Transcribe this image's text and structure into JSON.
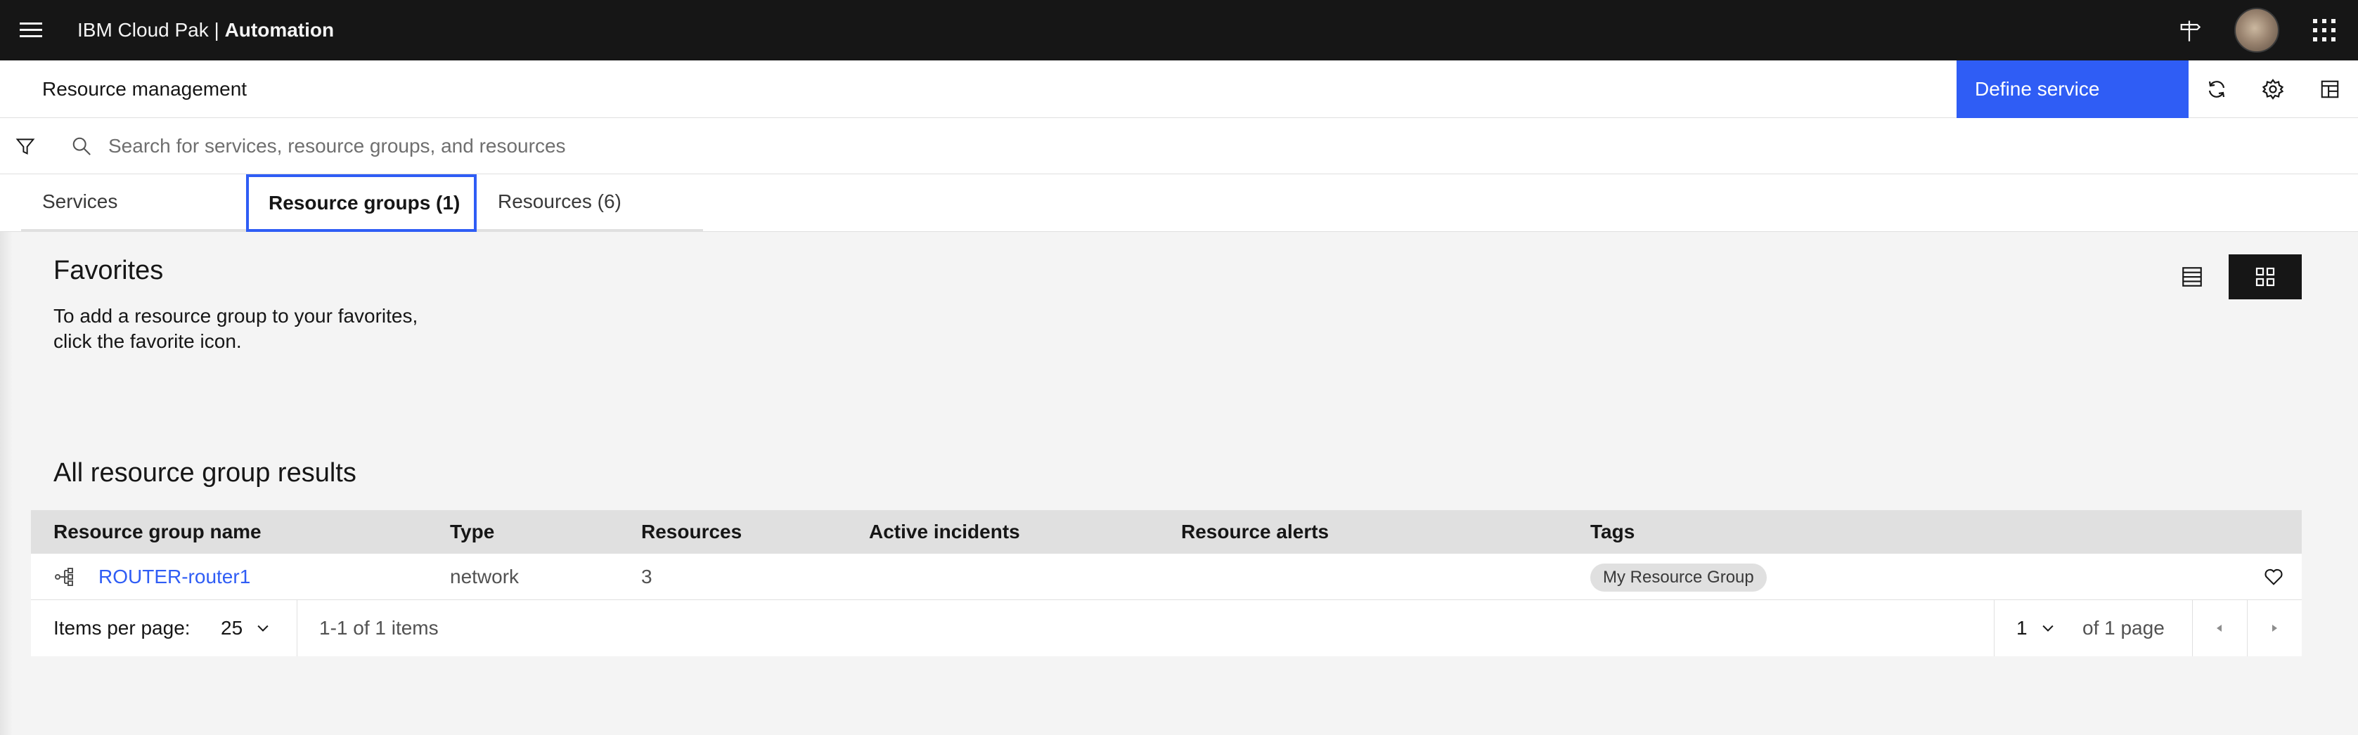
{
  "header": {
    "brand_prefix": "IBM Cloud Pak | ",
    "brand_product": "Automation",
    "icons": [
      "menu-icon",
      "signpost-icon",
      "avatar",
      "app-switcher-icon"
    ]
  },
  "title_bar": {
    "title": "Resource management",
    "define_button": "Define service",
    "icons": [
      "refresh-icon",
      "settings-icon",
      "layout-icon"
    ]
  },
  "search": {
    "placeholder": "Search for services, resource groups, and resources",
    "value": ""
  },
  "tabs": [
    {
      "label": "Services",
      "selected": false
    },
    {
      "label": "Resource groups (1)",
      "selected": true
    },
    {
      "label": "Resources (6)",
      "selected": false
    }
  ],
  "favorites": {
    "title": "Favorites",
    "description_line1": "To add a resource group to your favorites,",
    "description_line2": "click the favorite icon."
  },
  "view_toggle": {
    "options": [
      "list-view-icon",
      "grid-view-icon"
    ],
    "active": "grid-view-icon"
  },
  "results": {
    "title": "All resource group results",
    "columns": [
      "Resource group name",
      "Type",
      "Resources",
      "Active incidents",
      "Resource alerts",
      "Tags"
    ],
    "rows": [
      {
        "name": "ROUTER-router1",
        "type": "network",
        "resources": "3",
        "active_incidents": "",
        "resource_alerts": "",
        "tag": "My Resource Group"
      }
    ]
  },
  "pagination": {
    "items_per_page_label": "Items per page:",
    "items_per_page": "25",
    "range_text": "1-1 of 1 items",
    "page": "1",
    "page_total_text": "of 1 page"
  },
  "colors": {
    "header_bg": "#161616",
    "primary": "#2f5df5",
    "page_bg": "#f4f4f4",
    "table_header_bg": "#e0e0e0"
  }
}
